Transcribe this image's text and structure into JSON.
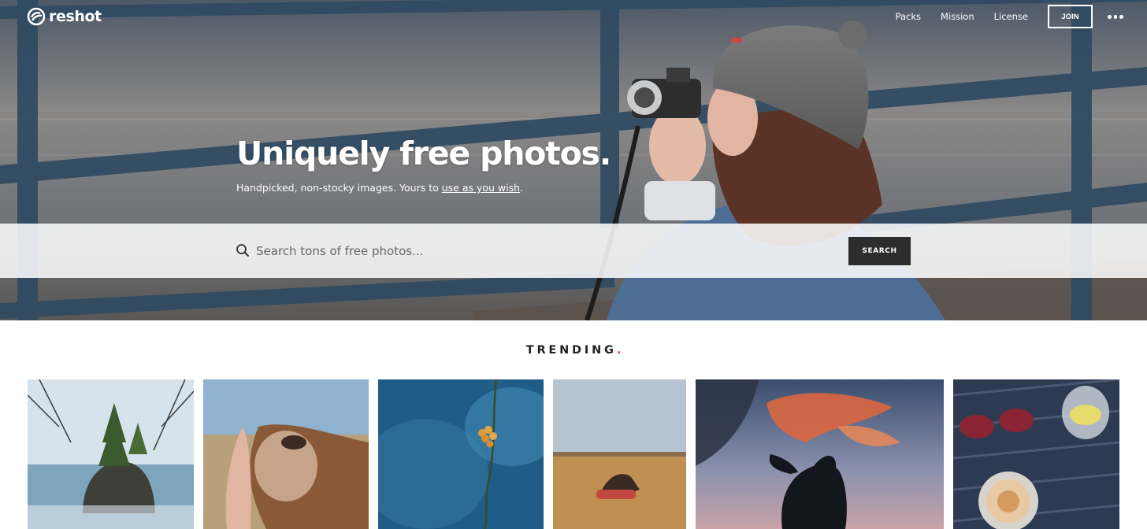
{
  "brand": {
    "name": "reshot"
  },
  "nav": {
    "links": [
      "Packs",
      "Mission",
      "License"
    ],
    "join_label": "JOIN",
    "more_icon": "more-horizontal-icon"
  },
  "hero": {
    "headline": "Uniquely free photos.",
    "subline_prefix": "Handpicked, non-stocky images. Yours to ",
    "subline_link": "use as you wish",
    "subline_suffix": "."
  },
  "search": {
    "placeholder": "Search tons of free photos...",
    "button_label": "SEARCH",
    "icon": "search-icon"
  },
  "trending": {
    "title": "TRENDING",
    "dot": ".",
    "accent_color": "#e23b2e",
    "photos": [
      "trees-on-rock-island",
      "hand-and-camel",
      "orange-berries-on-branch",
      "person-lying-in-field",
      "silhouette-at-sunset",
      "sunglasses-and-coffee"
    ]
  },
  "colors": {
    "search_button": "#2d2d2d",
    "text_dark": "#222222"
  }
}
